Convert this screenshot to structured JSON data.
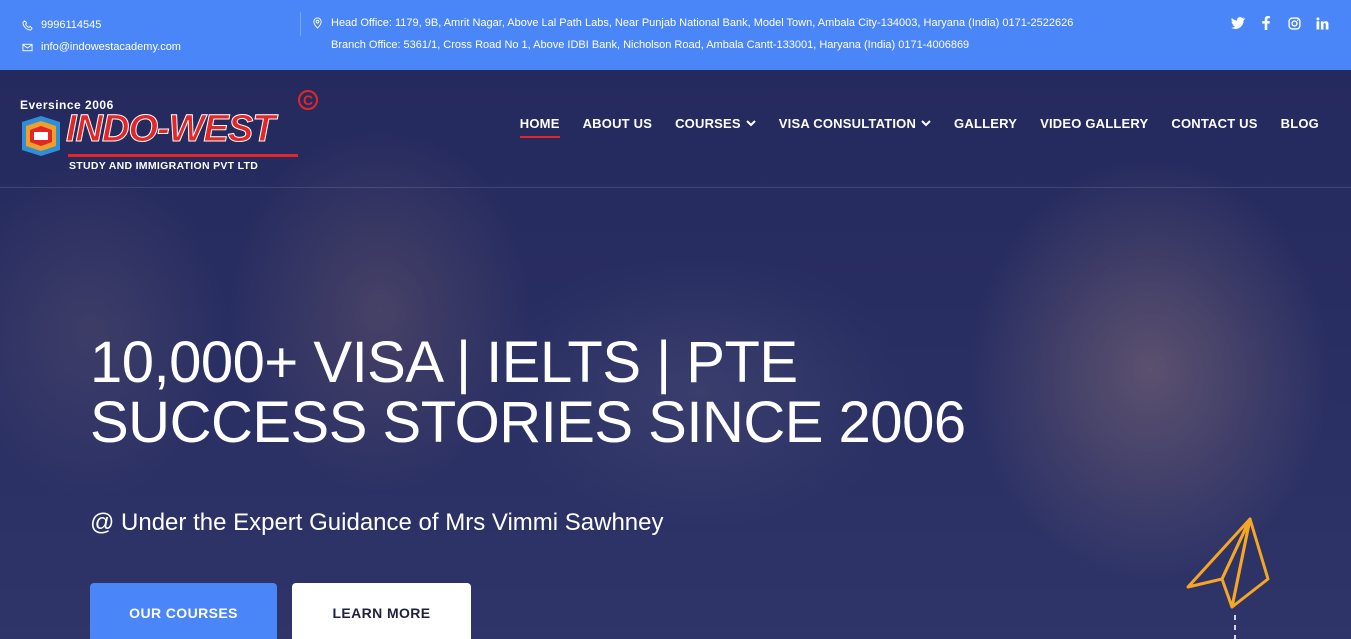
{
  "topbar": {
    "phone": "9996114545",
    "email": "info@indowestacademy.com",
    "head_office": "Head Office: 1179, 9B, Amrit Nagar, Above Lal Path Labs, Near Punjab National Bank, Model Town, Ambala City-134003, Haryana (India) 0171-2522626",
    "branch_office": "Branch Office: 5361/1, Cross Road No 1, Above IDBI Bank, Nicholson Road, Ambala Cantt-133001, Haryana (India) 0171-4006869",
    "social": [
      "twitter-icon",
      "facebook-icon",
      "instagram-icon",
      "linkedin-icon"
    ]
  },
  "logo": {
    "eversince": "Eversince 2006",
    "brand": "INDO-WEST",
    "copyright": "C",
    "tagline": "STUDY AND IMMIGRATION PVT LTD"
  },
  "nav": {
    "items": [
      {
        "label": "HOME",
        "active": true
      },
      {
        "label": "ABOUT US"
      },
      {
        "label": "COURSES",
        "dropdown": true
      },
      {
        "label": "VISA CONSULTATION",
        "dropdown": true
      },
      {
        "label": "GALLERY"
      },
      {
        "label": "VIDEO GALLERY"
      },
      {
        "label": "CONTACT US"
      },
      {
        "label": "BLOG"
      }
    ]
  },
  "hero": {
    "headline_line1": "10,000+ VISA | IELTS | PTE",
    "headline_line2": "SUCCESS STORIES SINCE 2006",
    "subline": "@ Under the Expert Guidance of Mrs Vimmi Sawhney",
    "primary_button": "OUR COURSES",
    "secondary_button": "LEARN MORE"
  },
  "colors": {
    "primary": "#4a86f7",
    "accent_red": "#e32626",
    "plane": "#f5a623"
  }
}
